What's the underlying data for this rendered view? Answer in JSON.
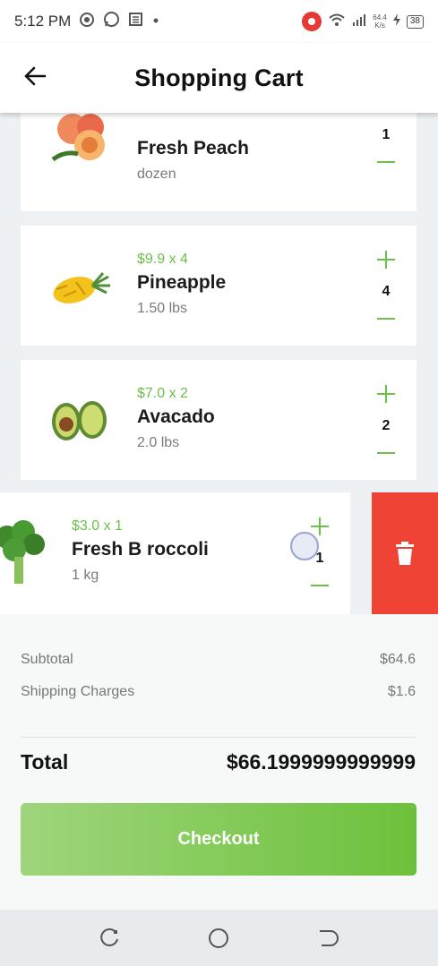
{
  "status_bar": {
    "time": "5:12 PM",
    "icons": [
      "settings-dot-icon",
      "whatsapp-icon",
      "news-icon",
      "dot-icon"
    ],
    "network_speed_value": "64.4",
    "network_speed_unit": "K/s",
    "battery": "38"
  },
  "app_bar": {
    "back_icon": "arrow-left-icon",
    "title": "Shopping Cart"
  },
  "cart": {
    "items": [
      {
        "price": "",
        "name": "Fresh Peach",
        "unit": "dozen",
        "qty": "1",
        "icon": "peach-image"
      },
      {
        "price": "$9.9 x 4",
        "name": "Pineapple",
        "unit": "1.50 lbs",
        "qty": "4",
        "icon": "pineapple-image"
      },
      {
        "price": "$7.0 x 2",
        "name": "Avacado",
        "unit": "2.0 lbs",
        "qty": "2",
        "icon": "avocado-image"
      },
      {
        "price": "$3.0 x 1",
        "name": "Fresh B roccoli",
        "unit": "1 kg",
        "qty": "1",
        "icon": "broccoli-image"
      }
    ],
    "delete_icon": "trash-icon"
  },
  "summary": {
    "subtotal_label": "Subtotal",
    "subtotal_value": "$64.6",
    "shipping_label": "Shipping Charges",
    "shipping_value": "$1.6",
    "total_label": "Total",
    "total_value": "$66.1999999999999",
    "checkout_label": "Checkout"
  },
  "colors": {
    "accent_green": "#6cc04a",
    "delete_red": "#ef4336"
  }
}
